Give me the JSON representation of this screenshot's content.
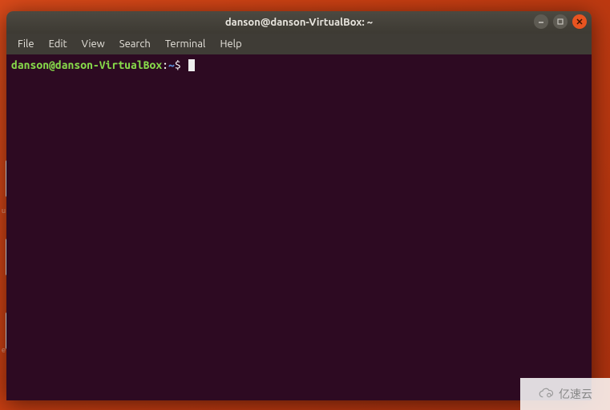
{
  "window": {
    "title": "danson@danson-VirtualBox: ~"
  },
  "menubar": {
    "items": [
      "File",
      "Edit",
      "View",
      "Search",
      "Terminal",
      "Help"
    ]
  },
  "prompt": {
    "user_host": "danson@danson-VirtualBox",
    "colon": ":",
    "path": "~",
    "dollar": "$"
  },
  "launcher_fragments": {
    "label1": "u",
    "label2": "",
    "label3": "e"
  },
  "watermark": {
    "text": "亿速云"
  }
}
